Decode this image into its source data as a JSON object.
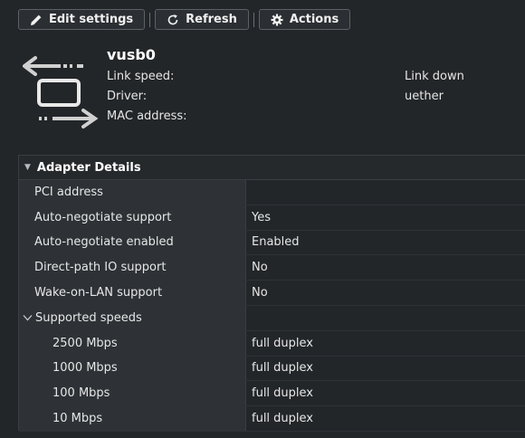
{
  "toolbar": {
    "edit_label": "Edit settings",
    "refresh_label": "Refresh",
    "actions_label": "Actions"
  },
  "adapter": {
    "name": "vusb0",
    "properties": [
      {
        "label": "Link speed:",
        "value": "Link down"
      },
      {
        "label": "Driver:",
        "value": "uether"
      },
      {
        "label": "MAC address:",
        "value": ""
      }
    ]
  },
  "details": {
    "title": "Adapter Details",
    "rows": [
      {
        "label": "PCI address",
        "value": ""
      },
      {
        "label": "Auto-negotiate support",
        "value": "Yes"
      },
      {
        "label": "Auto-negotiate enabled",
        "value": "Enabled"
      },
      {
        "label": "Direct-path IO support",
        "value": "No"
      },
      {
        "label": "Wake-on-LAN support",
        "value": "No"
      }
    ],
    "speeds_group": "Supported speeds",
    "speeds": [
      {
        "label": "2500 Mbps",
        "value": "full duplex"
      },
      {
        "label": "1000 Mbps",
        "value": "full duplex"
      },
      {
        "label": "100 Mbps",
        "value": "full duplex"
      },
      {
        "label": "10 Mbps",
        "value": "full duplex"
      }
    ]
  },
  "icons": [
    "pencil-icon",
    "refresh-icon",
    "gear-icon",
    "network-adapter-icon",
    "caret-down-icon",
    "chevron-down-icon"
  ]
}
